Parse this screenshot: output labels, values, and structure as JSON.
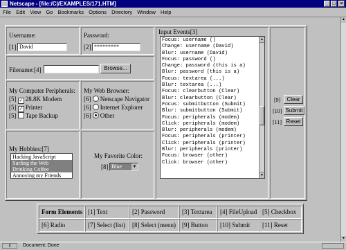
{
  "window": {
    "title": "Netscape - [file:/C|/EXAMPLES/171.HTM]"
  },
  "menu": [
    "File",
    "Edit",
    "View",
    "Go",
    "Bookmarks",
    "Options",
    "Directory",
    "Window",
    "Help"
  ],
  "form": {
    "username": {
      "label": "Username:",
      "index": "[1]",
      "value": "David"
    },
    "password": {
      "label": "Password:",
      "index": "[2]",
      "value": "*********"
    },
    "filename": {
      "label": "Filename:",
      "index": "[4]",
      "value": "",
      "browse": "Browse..."
    },
    "peripherals": {
      "label": "My Computer Peripherals:",
      "items": [
        {
          "index": "[5]",
          "label": "28.8K Modem",
          "checked": true
        },
        {
          "index": "[5]",
          "label": "Printer",
          "checked": true
        },
        {
          "index": "[5]",
          "label": "Tape Backup",
          "checked": false
        }
      ]
    },
    "browser": {
      "label": "My Web Browser:",
      "items": [
        {
          "index": "[6]",
          "label": "Netscape Navigator",
          "checked": false
        },
        {
          "index": "[6]",
          "label": "Internet Explorer",
          "checked": false
        },
        {
          "index": "[6]",
          "label": "Other",
          "checked": true
        }
      ]
    },
    "hobbies": {
      "label": "My Hobbies:[7]",
      "options": [
        "Hacking JavaScript",
        "Surfing the Web",
        "Drinking Coffee",
        "Annoying my Friends"
      ],
      "selected": [
        false,
        true,
        true,
        false
      ]
    },
    "color": {
      "label": "My Favorite Color:",
      "index": "[8]",
      "value": "Blue"
    },
    "events": {
      "label": "Input Events[3]",
      "lines": [
        "Focus: username ()",
        "Change: username (David)",
        "Blur: username (David)",
        "Focus: password ()",
        "Change: password (this is a)",
        "Blur: password (this is a)",
        "Focus: textarea (...)",
        "Blur: textarea (...)",
        "Focus: clearbutton (Clear)",
        "Blur: clearbutton (Clear)",
        "Focus: submitbutton (Submit)",
        "Blur: submitbutton (Submit)",
        "Focus: peripherals (modem)",
        "Click: peripherals (modem)",
        "Blur: peripherals (modem)",
        "Focus: peripherals (printer)",
        "Click: peripherals (printer)",
        "Blur: peripherals (printer)",
        "Focus: browser (other)",
        "Click: browser (other)"
      ]
    },
    "buttons": [
      {
        "index": "[9]",
        "label": "Clear"
      },
      {
        "index": "[10]",
        "label": "Submit"
      },
      {
        "index": "[11]",
        "label": "Reset"
      }
    ]
  },
  "nav": {
    "row1": [
      "Form Elements",
      "[1] Text",
      "[2] Password",
      "[3] Textarea",
      "[4] FileUpload",
      "[5] Checkbox"
    ],
    "row2": [
      "[6] Radio",
      "[7] Select (list)",
      "[8] Select (menu)",
      "[9] Button",
      "[10] Submit",
      "[11] Reset"
    ]
  },
  "status": {
    "text": "Document: Done"
  }
}
